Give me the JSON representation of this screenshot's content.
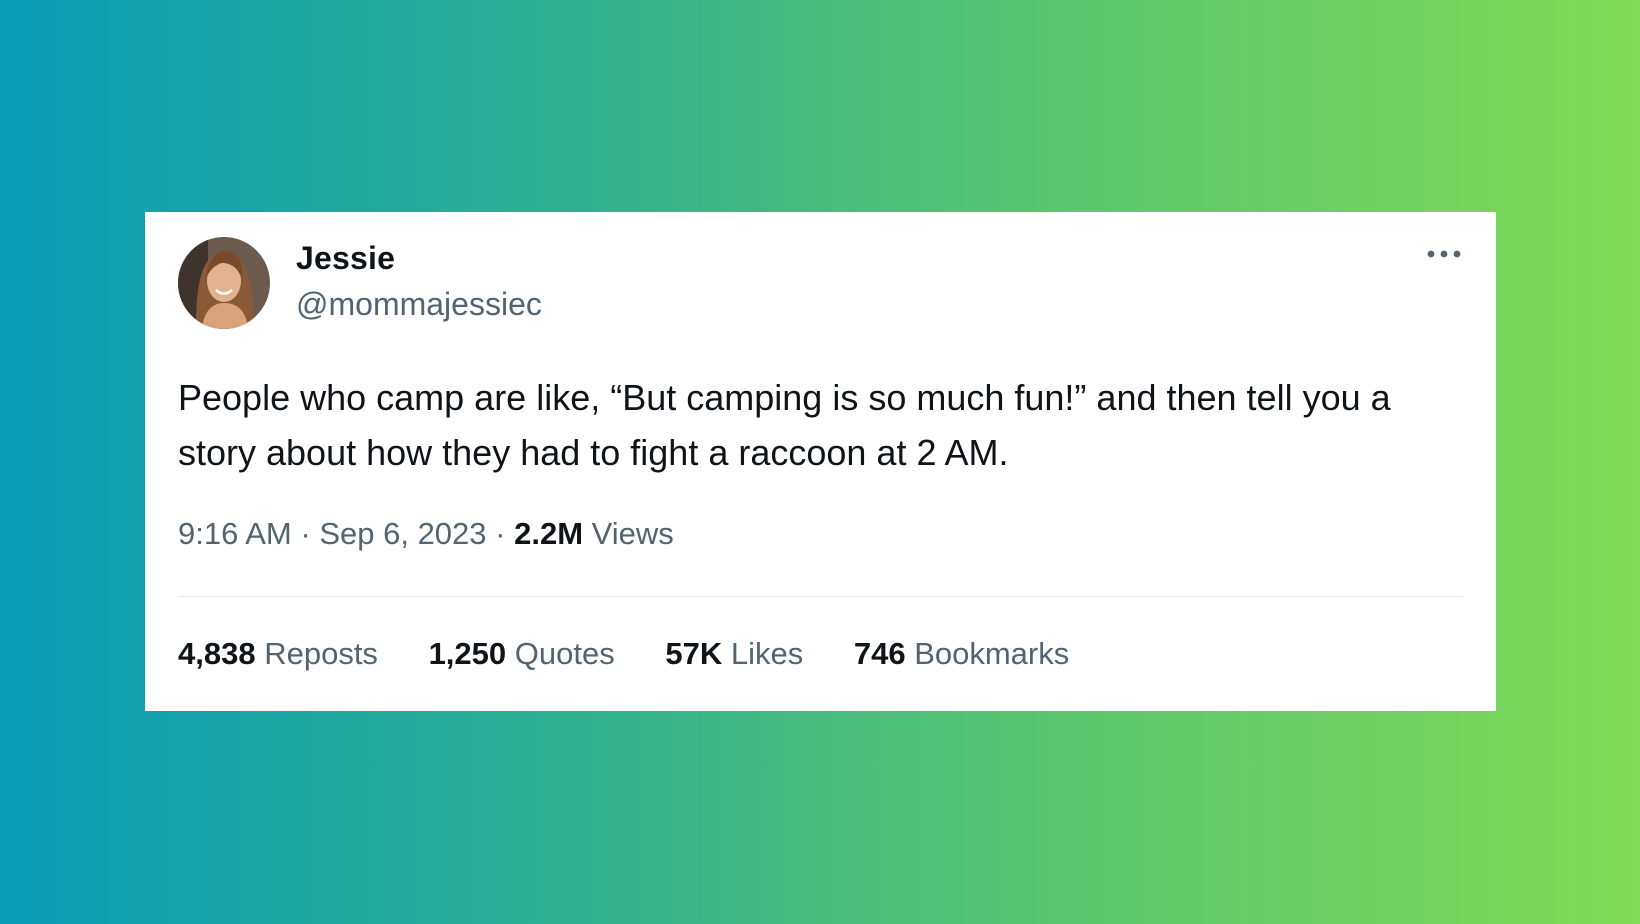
{
  "tweet": {
    "author": {
      "name": "Jessie",
      "handle": "@mommajessiec"
    },
    "more_icon": "ellipsis-icon",
    "text": "People who camp are like, “But camping is so much fun!” and then tell you a story about how they had to fight a raccoon at 2 AM.",
    "time": "9:16 AM",
    "separator": "·",
    "date": "Sep 6, 2023",
    "views_count": "2.2M",
    "views_label": "Views"
  },
  "stats": [
    {
      "count": "4,838",
      "label": "Reposts"
    },
    {
      "count": "1,250",
      "label": "Quotes"
    },
    {
      "count": "57K",
      "label": "Likes"
    },
    {
      "count": "746",
      "label": "Bookmarks"
    }
  ],
  "colors": {
    "background_gradient_start": "#0a9db8",
    "background_gradient_end": "#80d957",
    "card": "#ffffff",
    "primary_text": "#0f1419",
    "secondary_text": "#536471"
  }
}
